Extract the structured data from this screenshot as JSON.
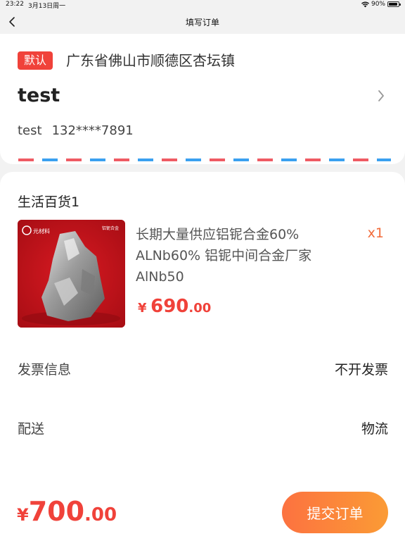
{
  "status_bar": {
    "time": "23:22",
    "date": "3月13日周一",
    "battery": "90%",
    "battery_level": 0.9
  },
  "nav": {
    "title": "填写订单",
    "back_icon": "chevron-left-icon"
  },
  "address": {
    "default_tag": "默认",
    "region": "广东省佛山市顺德区杏坛镇",
    "detail": "test",
    "contact_name": "test",
    "phone": "132****7891"
  },
  "order": {
    "store_name": "生活百货1",
    "product": {
      "title": "长期大量供应铝铌合金60% ALNb60% 铝铌中间合金厂家AlNb50",
      "quantity": "x1",
      "price_symbol": "¥",
      "price_int": "690",
      "price_dec": ".00",
      "image_brand": "元材料",
      "image_label": "铝铌合金"
    },
    "invoice_label": "发票信息",
    "invoice_value": "不开发票",
    "delivery_label": "配送",
    "delivery_value": "物流"
  },
  "footer": {
    "total_symbol": "¥",
    "total_int": "700",
    "total_dec": ".00",
    "submit_label": "提交订单"
  },
  "colors": {
    "accent_red": "#f0423a",
    "button_gradient_start": "#fc7240",
    "button_gradient_end": "#fb9b35",
    "quantity_orange": "#f26b3a"
  }
}
